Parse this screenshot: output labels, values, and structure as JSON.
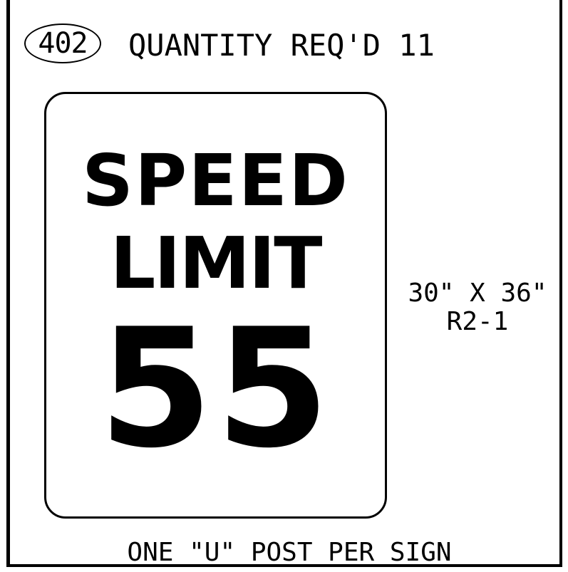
{
  "header": {
    "sheet_number": "402",
    "quantity_text": "QUANTITY REQ'D 11"
  },
  "sign": {
    "line_1": "SPEED",
    "line_2": "LIMIT",
    "speed_value": "55",
    "size": "30\" X 36\"",
    "code": "R2-1"
  },
  "footer": {
    "post_note": "ONE \"U\" POST PER SIGN"
  }
}
